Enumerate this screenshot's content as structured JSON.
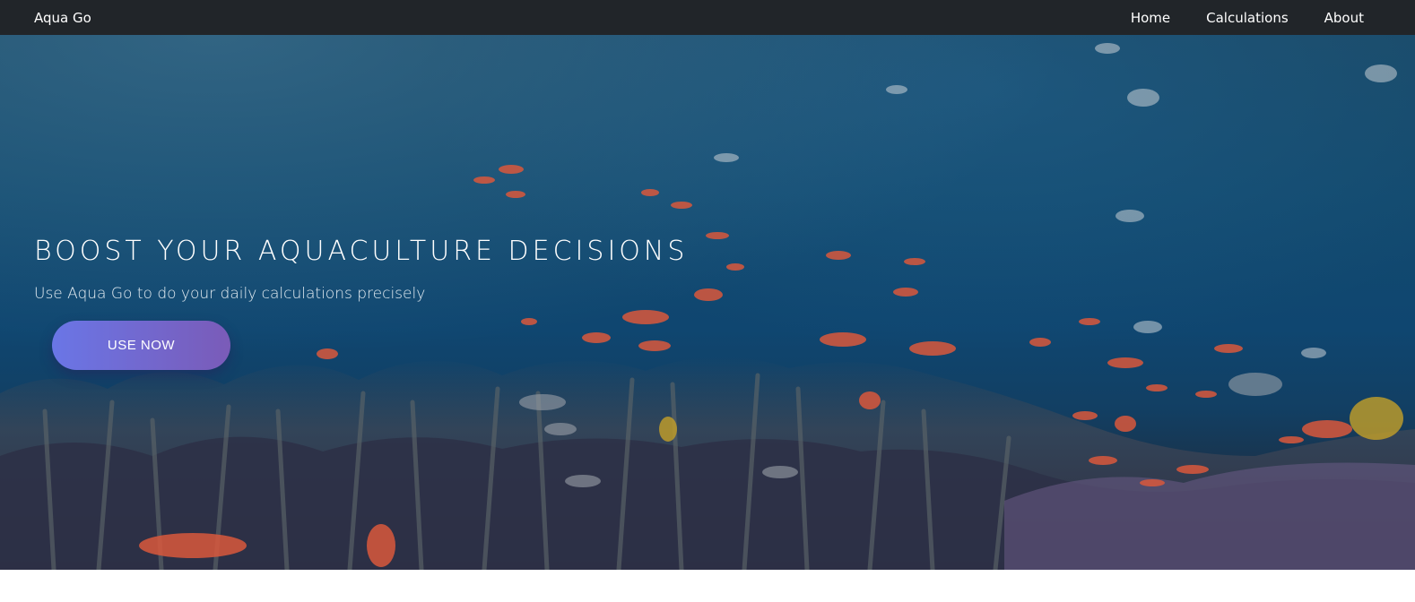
{
  "navbar": {
    "brand": "Aqua Go",
    "links": [
      {
        "label": "Home"
      },
      {
        "label": "Calculations"
      },
      {
        "label": "About"
      }
    ],
    "background": "#212529"
  },
  "hero": {
    "title": "BOOST YOUR AQUACULTURE DECISIONS",
    "subtitle": "Use Aqua Go to do your daily calculations precisely",
    "cta_label": "USE NOW",
    "cta_gradient": [
      "#6a76e6",
      "#7a5bb8"
    ],
    "background_image": "underwater coral reef with fish",
    "background_icon": "coral-reef-photo"
  }
}
